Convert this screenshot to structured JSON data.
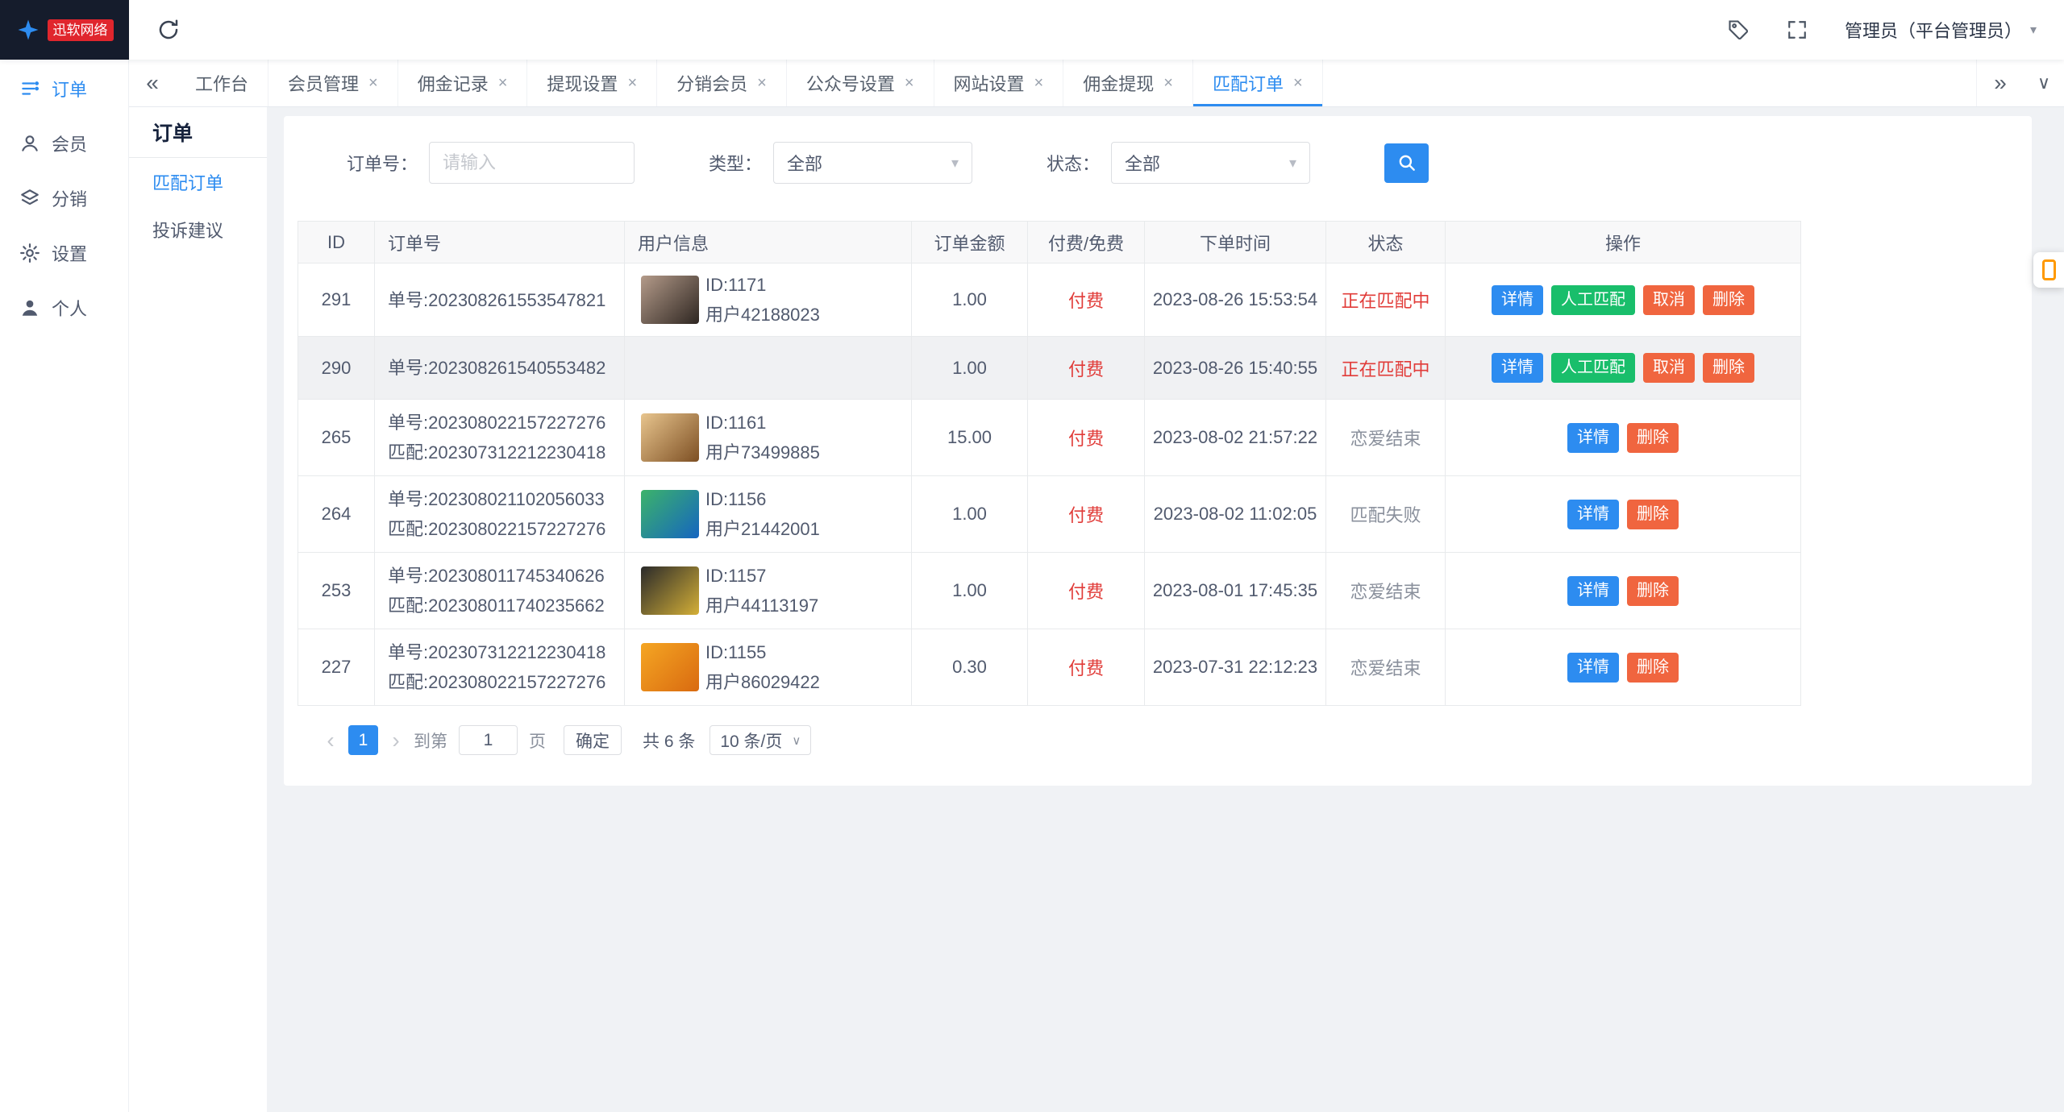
{
  "colors": {
    "primary": "#2d8cf0",
    "success": "#19be6b",
    "danger": "#f0653f",
    "red_text": "#e13c39",
    "status_gray": "#8a909c",
    "logo_bg": "#151c2c",
    "logo_badge": "#e0262d"
  },
  "icons": {
    "collapse": "«",
    "expand": "»",
    "chevron_down": "∨",
    "close": "×",
    "caret_down": "▾",
    "prev": "‹",
    "next": "›"
  },
  "topbar": {
    "logo_text": "迅软网络",
    "admin_label": "管理员（平台管理员）"
  },
  "sidebar": {
    "items": [
      {
        "key": "orders",
        "label": "订单",
        "icon": "order-icon",
        "active": true
      },
      {
        "key": "members",
        "label": "会员",
        "icon": "member-icon",
        "active": false
      },
      {
        "key": "distribution",
        "label": "分销",
        "icon": "distribution-icon",
        "active": false
      },
      {
        "key": "settings",
        "label": "设置",
        "icon": "settings-icon",
        "active": false
      },
      {
        "key": "profile",
        "label": "个人",
        "icon": "profile-icon",
        "active": false
      }
    ]
  },
  "tabs": [
    {
      "key": "workbench",
      "label": "工作台",
      "closable": false,
      "active": false
    },
    {
      "key": "member-management",
      "label": "会员管理",
      "closable": true,
      "active": false
    },
    {
      "key": "commission-records",
      "label": "佣金记录",
      "closable": true,
      "active": false
    },
    {
      "key": "withdrawal-settings",
      "label": "提现设置",
      "closable": true,
      "active": false
    },
    {
      "key": "distribution-members",
      "label": "分销会员",
      "closable": true,
      "active": false
    },
    {
      "key": "official-account-settings",
      "label": "公众号设置",
      "closable": true,
      "active": false
    },
    {
      "key": "website-settings",
      "label": "网站设置",
      "closable": true,
      "active": false
    },
    {
      "key": "commission-withdrawal",
      "label": "佣金提现",
      "closable": true,
      "active": false
    },
    {
      "key": "match-orders",
      "label": "匹配订单",
      "closable": true,
      "active": true
    }
  ],
  "submenu": {
    "title": "订单",
    "items": [
      {
        "key": "match-orders",
        "label": "匹配订单",
        "active": true
      },
      {
        "key": "complaints",
        "label": "投诉建议",
        "active": false
      }
    ]
  },
  "filters": {
    "order_no_label": "订单号：",
    "order_no_placeholder": "请输入",
    "type_label": "类型：",
    "type_value": "全部",
    "status_label": "状态：",
    "status_value": "全部"
  },
  "table": {
    "headers": [
      "ID",
      "订单号",
      "用户信息",
      "订单金额",
      "付费/免费",
      "下单时间",
      "状态",
      "操作"
    ],
    "rows": [
      {
        "id": "291",
        "order_lines": [
          "单号:202308261553547821"
        ],
        "user": {
          "id": "ID:1171",
          "name": "用户42188023",
          "avatar_colors": [
            "#b49b8a",
            "#2e2621"
          ]
        },
        "amount": "1.00",
        "fee": "付费",
        "time": "2023-08-26 15:53:54",
        "status": "正在匹配中",
        "status_type": "red",
        "highlight": false,
        "actions": [
          {
            "label": "详情",
            "type": "blue",
            "name": "detail-button"
          },
          {
            "label": "人工匹配",
            "type": "green",
            "name": "manual-match-button"
          },
          {
            "label": "取消",
            "type": "orange",
            "name": "cancel-button"
          },
          {
            "label": "删除",
            "type": "orange",
            "name": "delete-button"
          }
        ]
      },
      {
        "id": "290",
        "order_lines": [
          "单号:202308261540553482"
        ],
        "user": null,
        "amount": "1.00",
        "fee": "付费",
        "time": "2023-08-26 15:40:55",
        "status": "正在匹配中",
        "status_type": "red",
        "highlight": true,
        "actions": [
          {
            "label": "详情",
            "type": "blue",
            "name": "detail-button"
          },
          {
            "label": "人工匹配",
            "type": "green",
            "name": "manual-match-button"
          },
          {
            "label": "取消",
            "type": "orange",
            "name": "cancel-button"
          },
          {
            "label": "删除",
            "type": "orange",
            "name": "delete-button"
          }
        ]
      },
      {
        "id": "265",
        "order_lines": [
          "单号:202308022157227276",
          "匹配:202307312212230418"
        ],
        "user": {
          "id": "ID:1161",
          "name": "用户73499885",
          "avatar_colors": [
            "#e8c58e",
            "#7d4f23"
          ]
        },
        "amount": "15.00",
        "fee": "付费",
        "time": "2023-08-02 21:57:22",
        "status": "恋爱结束",
        "status_type": "gray",
        "highlight": false,
        "actions": [
          {
            "label": "详情",
            "type": "blue",
            "name": "detail-button"
          },
          {
            "label": "删除",
            "type": "orange",
            "name": "delete-button"
          }
        ]
      },
      {
        "id": "264",
        "order_lines": [
          "单号:202308021102056033",
          "匹配:202308022157227276"
        ],
        "user": {
          "id": "ID:1156",
          "name": "用户21442001",
          "avatar_colors": [
            "#3cb36a",
            "#1565c0"
          ]
        },
        "amount": "1.00",
        "fee": "付费",
        "time": "2023-08-02 11:02:05",
        "status": "匹配失败",
        "status_type": "gray",
        "highlight": false,
        "actions": [
          {
            "label": "详情",
            "type": "blue",
            "name": "detail-button"
          },
          {
            "label": "删除",
            "type": "orange",
            "name": "delete-button"
          }
        ]
      },
      {
        "id": "253",
        "order_lines": [
          "单号:202308011745340626",
          "匹配:202308011740235662"
        ],
        "user": {
          "id": "ID:1157",
          "name": "用户44113197",
          "avatar_colors": [
            "#2a2a2a",
            "#d4af37"
          ]
        },
        "amount": "1.00",
        "fee": "付费",
        "time": "2023-08-01 17:45:35",
        "status": "恋爱结束",
        "status_type": "gray",
        "highlight": false,
        "actions": [
          {
            "label": "详情",
            "type": "blue",
            "name": "detail-button"
          },
          {
            "label": "删除",
            "type": "orange",
            "name": "delete-button"
          }
        ]
      },
      {
        "id": "227",
        "order_lines": [
          "单号:202307312212230418",
          "匹配:202308022157227276"
        ],
        "user": {
          "id": "ID:1155",
          "name": "用户86029422",
          "avatar_colors": [
            "#f5a623",
            "#d96a10"
          ]
        },
        "amount": "0.30",
        "fee": "付费",
        "time": "2023-07-31 22:12:23",
        "status": "恋爱结束",
        "status_type": "gray",
        "highlight": false,
        "actions": [
          {
            "label": "详情",
            "type": "blue",
            "name": "detail-button"
          },
          {
            "label": "删除",
            "type": "orange",
            "name": "delete-button"
          }
        ]
      }
    ]
  },
  "pagination": {
    "current": "1",
    "jump_before": "到第",
    "jump_value": "1",
    "jump_after": "页",
    "confirm_label": "确定",
    "total_label": "共 6 条",
    "page_size_label": "10 条/页"
  }
}
